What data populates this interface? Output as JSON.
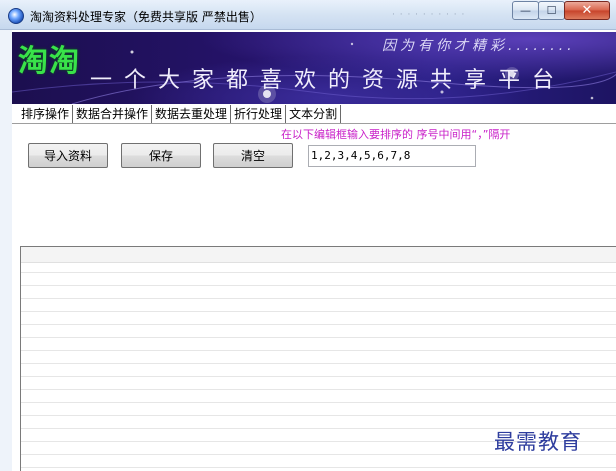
{
  "window": {
    "title": "淘淘资料处理专家（免费共享版 严禁出售）",
    "title_ghost": "· · ·  · · · · · · ·",
    "controls": {
      "minimize": "—",
      "maximize": "☐",
      "close": "✕"
    }
  },
  "banner": {
    "logo": "淘淘",
    "top_text": "因为有你才精彩........",
    "slogan": "一个大家都喜欢的资源共享平台"
  },
  "tabs": [
    {
      "label": "排序操作",
      "active": true
    },
    {
      "label": "数据合并操作",
      "active": false
    },
    {
      "label": "数据去重处理",
      "active": false
    },
    {
      "label": "折行处理",
      "active": false
    },
    {
      "label": "文本分割",
      "active": false
    }
  ],
  "hint": "在以下编辑框输入要排序的 序号中间用“，”隔开",
  "toolbar": {
    "import_label": "导入资料",
    "save_label": "保存",
    "clear_label": "清空"
  },
  "sequence": {
    "value": "1,2,3,4,5,6,7,8"
  },
  "watermark": "最需教育",
  "colors": {
    "banner_bg": "#25136a",
    "logo": "#39e24a",
    "hint": "#c81ec8",
    "watermark": "#2e3d9e"
  }
}
